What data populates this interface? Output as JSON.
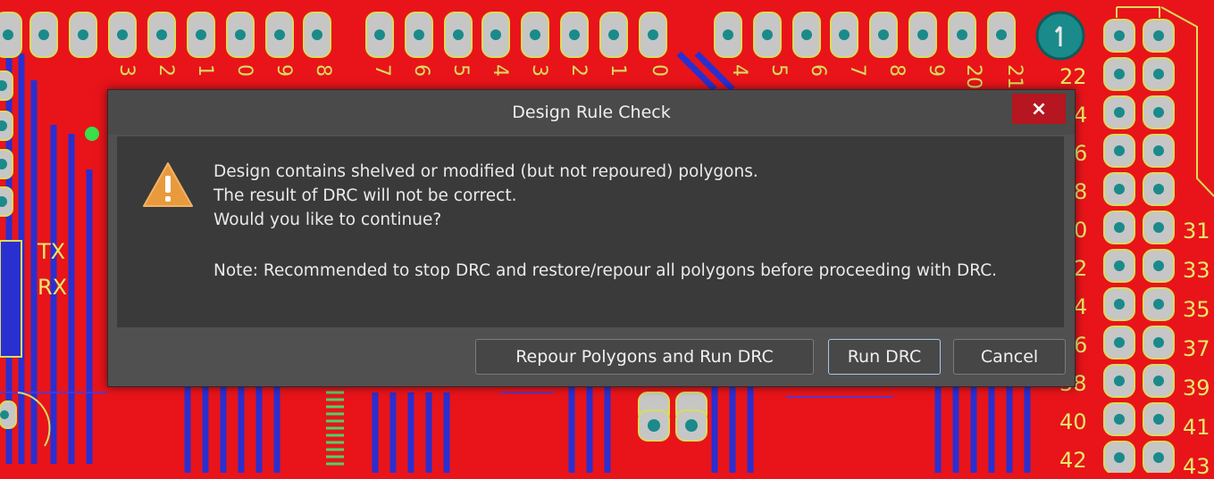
{
  "background": {
    "board_colors": {
      "copper_top": "#e8141a",
      "copper_bottom": "#2a2fd0",
      "pad": "#c6c6c6",
      "via": "#1a8a8a",
      "silkscreen": "#d9dc5c"
    },
    "top_labels": [
      "3",
      "2",
      "1",
      "0",
      "9",
      "8",
      "7",
      "6",
      "5",
      "4",
      "3",
      "2",
      "1",
      "0",
      "4",
      "5",
      "6",
      "7",
      "8",
      "9",
      "20",
      "21"
    ],
    "right_labels": [
      "22",
      "4",
      "6",
      "8",
      "0",
      "2",
      "4",
      "6",
      "38",
      "40",
      "42"
    ],
    "far_right_labels": [
      "31",
      "33",
      "35",
      "37",
      "39",
      "41",
      "43"
    ],
    "left_labels": [
      "TX",
      "RX"
    ]
  },
  "dialog": {
    "title": "Design Rule Check",
    "close_glyph": "×",
    "icon": "warning-triangle-icon",
    "message_lines": [
      "Design contains shelved or modified (but not repoured) polygons.",
      "The result of DRC will not be correct.",
      "Would you like to continue?"
    ],
    "note": "Note: Recommended to stop DRC and restore/repour all polygons before proceeding with DRC.",
    "buttons": {
      "repour": "Repour Polygons and Run DRC",
      "run": "Run DRC",
      "cancel": "Cancel"
    },
    "accent_color": "#a9c7ea",
    "close_color": "#b5161f"
  }
}
